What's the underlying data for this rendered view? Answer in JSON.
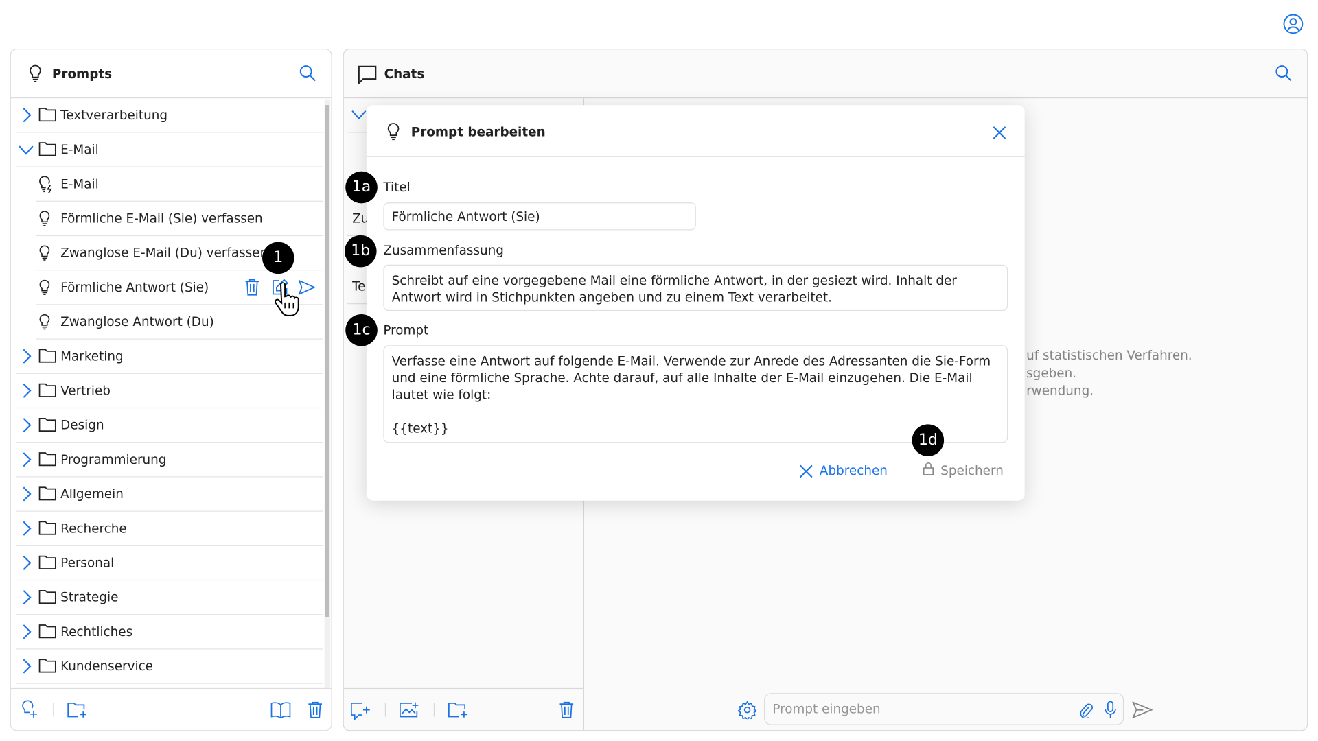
{
  "colors": {
    "accent": "#1a73e8",
    "badge": "#000000",
    "muted": "#888888"
  },
  "prompts_panel": {
    "title": "Prompts",
    "items": [
      {
        "label": "Textverarbeitung",
        "type": "folder",
        "expanded": false
      },
      {
        "label": "E-Mail",
        "type": "folder",
        "expanded": true
      },
      {
        "label": "E-Mail",
        "type": "prompt-ai"
      },
      {
        "label": "Förmliche E-Mail (Sie) verfassen",
        "type": "prompt"
      },
      {
        "label": "Zwanglose E-Mail (Du) verfassen",
        "type": "prompt"
      },
      {
        "label": "Förmliche Antwort (Sie)",
        "type": "prompt",
        "hovered": true
      },
      {
        "label": "Zwanglose Antwort (Du)",
        "type": "prompt"
      },
      {
        "label": "Marketing",
        "type": "folder"
      },
      {
        "label": "Vertrieb",
        "type": "folder"
      },
      {
        "label": "Design",
        "type": "folder"
      },
      {
        "label": "Programmierung",
        "type": "folder"
      },
      {
        "label": "Allgemein",
        "type": "folder"
      },
      {
        "label": "Recherche",
        "type": "folder"
      },
      {
        "label": "Personal",
        "type": "folder"
      },
      {
        "label": "Strategie",
        "type": "folder"
      },
      {
        "label": "Rechtliches",
        "type": "folder"
      },
      {
        "label": "Kundenservice",
        "type": "folder"
      }
    ]
  },
  "chats_panel": {
    "title": "Chats",
    "partial_labels": [
      "Zu",
      "Te:"
    ],
    "background_text": [
      "uf statistischen Verfahren.",
      "sgeben.",
      "rwendung."
    ],
    "prompt_placeholder": "Prompt eingeben"
  },
  "dialog": {
    "title": "Prompt bearbeiten",
    "title_label": "Titel",
    "title_value": "Förmliche Antwort (Sie)",
    "summary_label": "Zusammenfassung",
    "summary_value": "Schreibt auf eine vorgegebene Mail eine förmliche Antwort, in der gesiezt wird. Inhalt der Antwort wird in Stichpunkten angeben und zu einem Text verarbeitet.",
    "prompt_label": "Prompt",
    "prompt_value": "Verfasse eine Antwort auf folgende E-Mail. Verwende zur Anrede des Adressanten die Sie-Form und eine förmliche Sprache. Achte darauf, auf alle Inhalte der E-Mail einzugehen. Die E-Mail lautet wie folgt:\n\n{{text}}",
    "cancel_label": "Abbrechen",
    "save_label": "Speichern"
  },
  "badges": {
    "b1": "1",
    "b1a": "1a",
    "b1b": "1b",
    "b1c": "1c",
    "b1d": "1d"
  }
}
